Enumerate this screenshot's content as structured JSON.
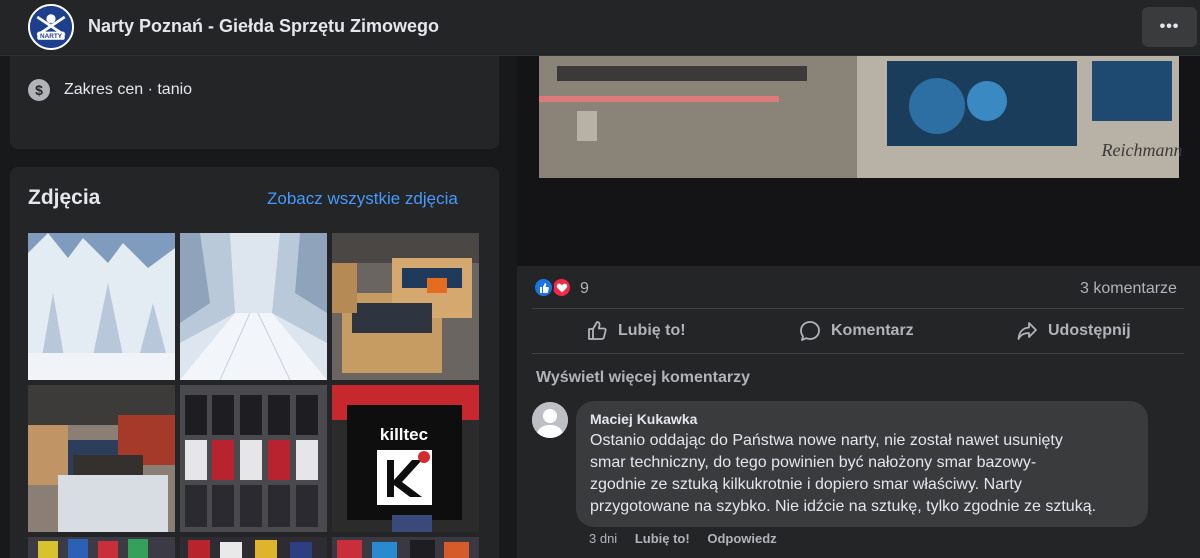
{
  "header": {
    "group_name": "Narty Poznań - Giełda Sprzętu Zimowego",
    "logo_text": "NARTY",
    "more_label": "•••"
  },
  "about": {
    "price_icon": "dollar-icon",
    "price_range": "Zakres cen · tanio"
  },
  "photos": {
    "title": "Zdjęcia",
    "see_all": "Zobacz wszystkie zdjęcia",
    "thumbnails": [
      {
        "subject": "snowy-forest"
      },
      {
        "subject": "snowy-trail"
      },
      {
        "subject": "boxes-of-gear"
      },
      {
        "subject": "shop-shelves-boxes"
      },
      {
        "subject": "gloves-rack"
      },
      {
        "subject": "killtec-display"
      },
      {
        "subject": "jackets-rack-1"
      },
      {
        "subject": "jackets-rack-2"
      },
      {
        "subject": "jackets-rack-3"
      }
    ],
    "killtec_text": "killtec"
  },
  "post": {
    "video_brand": "Reichmann",
    "reaction_count": "9",
    "comment_count": "3 komentarze",
    "actions": {
      "like": "Lubię to!",
      "comment": "Komentarz",
      "share": "Udostępnij"
    },
    "more_comments": "Wyświetl więcej komentarzy",
    "comment": {
      "author": "Maciej Kukawka",
      "lines": [
        "Ostanio oddając do Państwa nowe narty, nie został nawet usunięty",
        "smar techniczny, do tego powinien być nałożony smar bazowy-",
        "zgodnie ze sztuką kilkukrotnie i dopiero smar właściwy. Narty",
        "przygotowane na szybko. Nie idźcie na sztukę, tylko zgodnie ze sztuką."
      ],
      "time": "3 dni",
      "like": "Lubię to!",
      "reply": "Odpowiedz"
    }
  },
  "colors": {
    "background": "#18191a",
    "card": "#242526",
    "link": "#4599ff",
    "like_blue": "#1b74e4",
    "love_red": "#f02849"
  }
}
